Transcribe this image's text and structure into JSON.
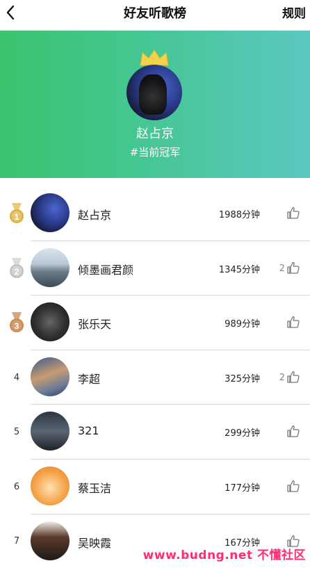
{
  "nav": {
    "back_icon": "chevron-left-icon",
    "title": "好友听歌榜",
    "rules_label": "规则"
  },
  "hero": {
    "crown_icon": "crown-icon",
    "champion_name": "赵占京",
    "champion_tag": "#当前冠军",
    "gradient_colors": [
      "#3cc46f",
      "#5bc8c1"
    ]
  },
  "ranking": [
    {
      "rank": "1",
      "medal": "gold",
      "name": "赵占京",
      "minutes": "1988分钟",
      "likes": ""
    },
    {
      "rank": "2",
      "medal": "silver",
      "name": "倾墨画君颜",
      "minutes": "1345分钟",
      "likes": "2"
    },
    {
      "rank": "3",
      "medal": "bronze",
      "name": "张乐天",
      "minutes": "989分钟",
      "likes": ""
    },
    {
      "rank": "4",
      "medal": "",
      "name": "李超",
      "minutes": "325分钟",
      "likes": "2"
    },
    {
      "rank": "5",
      "medal": "",
      "name": "321",
      "minutes": "299分钟",
      "likes": ""
    },
    {
      "rank": "6",
      "medal": "",
      "name": "蔡玉洁",
      "minutes": "177分钟",
      "likes": ""
    },
    {
      "rank": "7",
      "medal": "",
      "name": "吴映霞",
      "minutes": "167分钟",
      "likes": ""
    }
  ],
  "watermark": "www.budng.net 不懂社区",
  "colors": {
    "gold": "#d9b24a",
    "silver": "#c2c2c2",
    "bronze": "#c98b5a"
  }
}
